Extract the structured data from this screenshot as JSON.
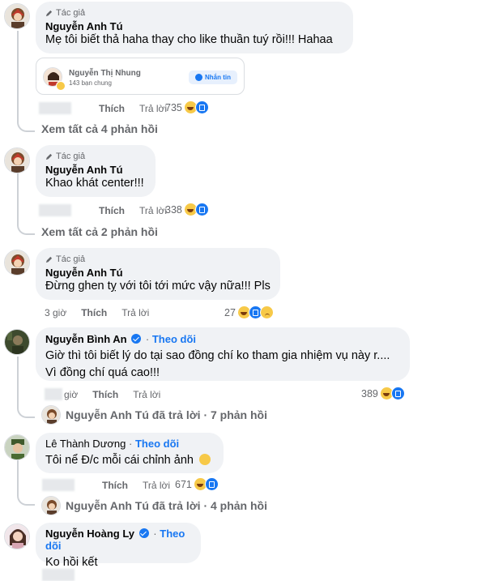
{
  "labels": {
    "author_badge": "Tác giả",
    "like": "Thích",
    "reply": "Trả lời",
    "follow": "Theo dõi"
  },
  "comments": [
    {
      "author": "Nguyễn Anh Tú",
      "text": "Mẹ tôi biết thả haha thay cho like thuần tuý rồi!!! Hahaa",
      "tagged_card": {
        "name": "Nguyễn Thị Nhung",
        "sub": "143 bạn chung",
        "button": "Nhắn tin"
      },
      "reactions": "735",
      "see_more": "Xem tất cả 4 phản hồi"
    },
    {
      "author": "Nguyễn Anh Tú",
      "text": "Khao khát center!!!",
      "reactions": "338",
      "see_more": "Xem tất cả 2 phản hồi"
    },
    {
      "author": "Nguyễn Anh Tú",
      "text": "Đừng ghen tỵ với tôi tới mức vậy nữa!!! Pls",
      "time": "3 giờ",
      "reactions": "27"
    },
    {
      "author": "Nguyễn Bình An",
      "text_line1": "Giờ thì tôi biết lý do tại sao đồng chí ko tham gia nhiệm vụ này r....",
      "text_line2": "Vì đồng chí quá cao!!!",
      "time_suffix": "giờ",
      "reactions": "389",
      "reply_summary": "Nguyễn Anh Tú đã trả lời · 7 phản hồi"
    },
    {
      "author": "Lê Thành Dương",
      "text": "Tôi nể Đ/c mỗi cái chỉnh ảnh",
      "reactions": "671",
      "reply_summary": "Nguyễn Anh Tú đã trả lời · 4 phản hồi"
    },
    {
      "author": "Nguyễn Hoàng Ly",
      "text": "Ko hồi kết"
    }
  ],
  "colors": {
    "link_blue": "#1877f2",
    "bubble_bg": "#f0f2f5",
    "meta_gray": "#65676b"
  }
}
